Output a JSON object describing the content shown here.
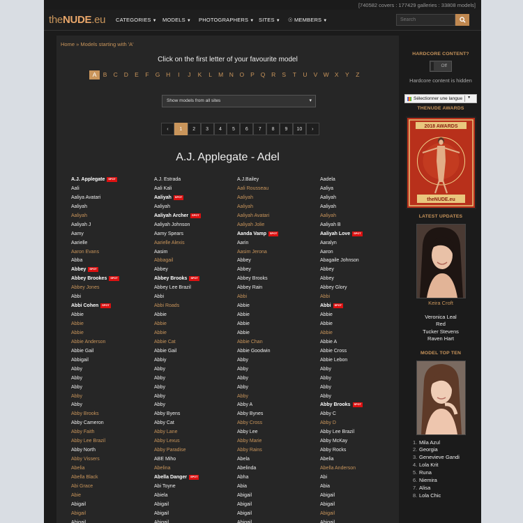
{
  "stats": "[740582 covers : 177429 galleries : 33808 models]",
  "logo": {
    "prefix": "the",
    "main": "NUDE",
    "suffix": ".eu"
  },
  "nav": [
    {
      "label": "CATEGORIES"
    },
    {
      "label": "MODELS"
    },
    {
      "label": "PHOTOGRAPHERS"
    },
    {
      "label": "SITES"
    },
    {
      "label": "MEMBERS"
    }
  ],
  "search": {
    "placeholder": "Search"
  },
  "breadcrumb": {
    "home": "Home",
    "sep": " » ",
    "current": "Models starting with 'A'"
  },
  "instruction": "Click on the first letter of your favourite model",
  "letters": [
    "A",
    "B",
    "C",
    "D",
    "E",
    "F",
    "G",
    "H",
    "I",
    "J",
    "K",
    "L",
    "M",
    "N",
    "O",
    "P",
    "Q",
    "R",
    "S",
    "T",
    "U",
    "V",
    "W",
    "X",
    "Y",
    "Z"
  ],
  "active_letter": "A",
  "site_filter": {
    "selected": "Show models from all sites"
  },
  "pagination": {
    "prev": "‹",
    "pages": [
      "1",
      "2",
      "3",
      "4",
      "5",
      "6",
      "7",
      "8",
      "9",
      "10"
    ],
    "active": "1",
    "next": "›"
  },
  "range_title": "A.J. Applegate - Adel",
  "spot_label": "SPOT",
  "columns": [
    [
      {
        "name": "A.J. Applegate",
        "style": "b",
        "spot": true
      },
      {
        "name": "Aali",
        "style": "w"
      },
      {
        "name": "Aaliya Avatari",
        "style": "w"
      },
      {
        "name": "Aaliyah",
        "style": "w"
      },
      {
        "name": "Aaliyah",
        "style": "o"
      },
      {
        "name": "Aaliyah J",
        "style": "w"
      },
      {
        "name": "Aamy",
        "style": "w"
      },
      {
        "name": "Aarielle",
        "style": "w"
      },
      {
        "name": "Aaron Evans",
        "style": "o"
      },
      {
        "name": "Abba",
        "style": "w"
      },
      {
        "name": "Abbey",
        "style": "b",
        "spot": true
      },
      {
        "name": "Abbey Brookes",
        "style": "b",
        "spot": true
      },
      {
        "name": "Abbey Jones",
        "style": "o"
      },
      {
        "name": "Abbi",
        "style": "w"
      },
      {
        "name": "Abbi Cohen",
        "style": "b",
        "spot": true
      },
      {
        "name": "Abbie",
        "style": "w"
      },
      {
        "name": "Abbie",
        "style": "o"
      },
      {
        "name": "Abbie",
        "style": "o"
      },
      {
        "name": "Abbie Anderson",
        "style": "o"
      },
      {
        "name": "Abbie Gail",
        "style": "w"
      },
      {
        "name": "Abbigail",
        "style": "w"
      },
      {
        "name": "Abby",
        "style": "w"
      },
      {
        "name": "Abby",
        "style": "w"
      },
      {
        "name": "Abby",
        "style": "w"
      },
      {
        "name": "Abby",
        "style": "o"
      },
      {
        "name": "Abby",
        "style": "w"
      },
      {
        "name": "Abby Brooks",
        "style": "o"
      },
      {
        "name": "Abby Cameron",
        "style": "w"
      },
      {
        "name": "Abby Faith",
        "style": "o"
      },
      {
        "name": "Abby Lee Brazil",
        "style": "o"
      },
      {
        "name": "Abby North",
        "style": "w"
      },
      {
        "name": "Abby Vissers",
        "style": "o"
      },
      {
        "name": "Abelia",
        "style": "o"
      },
      {
        "name": "Abella Black",
        "style": "o"
      },
      {
        "name": "Abi Grace",
        "style": "o"
      },
      {
        "name": "Abie",
        "style": "o"
      },
      {
        "name": "Abigail",
        "style": "w"
      },
      {
        "name": "Abigail",
        "style": "o"
      },
      {
        "name": "Abigail",
        "style": "w"
      }
    ],
    [
      {
        "name": "A.J. Estrada",
        "style": "w"
      },
      {
        "name": "Aali Kali",
        "style": "w"
      },
      {
        "name": "Aaliyah",
        "style": "b",
        "spot": true
      },
      {
        "name": "Aaliyah",
        "style": "w"
      },
      {
        "name": "Aaliyah Archer",
        "style": "b",
        "spot": true
      },
      {
        "name": "Aaliyah Johnson",
        "style": "w"
      },
      {
        "name": "Aamy Spears",
        "style": "w"
      },
      {
        "name": "Aarielle Alexis",
        "style": "o"
      },
      {
        "name": "Aasim",
        "style": "w"
      },
      {
        "name": "Abbagail",
        "style": "o"
      },
      {
        "name": "Abbey",
        "style": "w"
      },
      {
        "name": "Abbey Brooks",
        "style": "b",
        "spot": true
      },
      {
        "name": "Abbey Lee Brazil",
        "style": "w"
      },
      {
        "name": "Abbi",
        "style": "w"
      },
      {
        "name": "Abbi Roads",
        "style": "o"
      },
      {
        "name": "Abbie",
        "style": "w"
      },
      {
        "name": "Abbie",
        "style": "o"
      },
      {
        "name": "Abbie",
        "style": "o"
      },
      {
        "name": "Abbie Cat",
        "style": "o"
      },
      {
        "name": "Abbie Gail",
        "style": "w"
      },
      {
        "name": "Abbiy",
        "style": "w"
      },
      {
        "name": "Abby",
        "style": "w"
      },
      {
        "name": "Abby",
        "style": "w"
      },
      {
        "name": "Abby",
        "style": "w"
      },
      {
        "name": "Abby",
        "style": "w"
      },
      {
        "name": "Abby",
        "style": "w"
      },
      {
        "name": "Abby Byens",
        "style": "w"
      },
      {
        "name": "Abby Cat",
        "style": "w"
      },
      {
        "name": "Abby Lane",
        "style": "o"
      },
      {
        "name": "Abby Lexus",
        "style": "o"
      },
      {
        "name": "Abby Paradise",
        "style": "o"
      },
      {
        "name": "ABE Miho",
        "style": "w"
      },
      {
        "name": "Abelina",
        "style": "o"
      },
      {
        "name": "Abella Danger",
        "style": "b",
        "spot": true
      },
      {
        "name": "Abi Toyne",
        "style": "w"
      },
      {
        "name": "Abiela",
        "style": "w"
      },
      {
        "name": "Abigail",
        "style": "w"
      },
      {
        "name": "Abigail",
        "style": "w"
      },
      {
        "name": "Abigail",
        "style": "w"
      }
    ],
    [
      {
        "name": "A.J.Bailey",
        "style": "w"
      },
      {
        "name": "Aali Rousseau",
        "style": "o"
      },
      {
        "name": "Aaliyah",
        "style": "o"
      },
      {
        "name": "Aaliyah",
        "style": "o"
      },
      {
        "name": "Aaliyah Avatari",
        "style": "o"
      },
      {
        "name": "Aaliyah Jolie",
        "style": "o"
      },
      {
        "name": "Aanda Vamp",
        "style": "b",
        "spot": true
      },
      {
        "name": "Aarin",
        "style": "w"
      },
      {
        "name": "Aasim Jerona",
        "style": "o"
      },
      {
        "name": "Abbey",
        "style": "w"
      },
      {
        "name": "Abbey",
        "style": "w"
      },
      {
        "name": "Abbey Brooks",
        "style": "w"
      },
      {
        "name": "Abbey Rain",
        "style": "w"
      },
      {
        "name": "Abbi",
        "style": "o"
      },
      {
        "name": "Abbie",
        "style": "w"
      },
      {
        "name": "Abbie",
        "style": "w"
      },
      {
        "name": "Abbie",
        "style": "w"
      },
      {
        "name": "Abbie",
        "style": "w"
      },
      {
        "name": "Abbie Chan",
        "style": "o"
      },
      {
        "name": "Abbie Goodwin",
        "style": "w"
      },
      {
        "name": "Abby",
        "style": "w"
      },
      {
        "name": "Abby",
        "style": "w"
      },
      {
        "name": "Abby",
        "style": "w"
      },
      {
        "name": "Abby",
        "style": "w"
      },
      {
        "name": "Abby",
        "style": "o"
      },
      {
        "name": "Abby A",
        "style": "w"
      },
      {
        "name": "Abby Bynes",
        "style": "w"
      },
      {
        "name": "Abby Cross",
        "style": "o"
      },
      {
        "name": "Abby Lee",
        "style": "w"
      },
      {
        "name": "Abby Marie",
        "style": "o"
      },
      {
        "name": "Abby Rains",
        "style": "o"
      },
      {
        "name": "Abela",
        "style": "w"
      },
      {
        "name": "Abelinda",
        "style": "w"
      },
      {
        "name": "Abha",
        "style": "w"
      },
      {
        "name": "Abia",
        "style": "w"
      },
      {
        "name": "Abigail",
        "style": "w"
      },
      {
        "name": "Abigail",
        "style": "w"
      },
      {
        "name": "Abigail",
        "style": "w"
      },
      {
        "name": "Abigail",
        "style": "w"
      }
    ],
    [
      {
        "name": "Aadela",
        "style": "w"
      },
      {
        "name": "Aaliya",
        "style": "w"
      },
      {
        "name": "Aaliyah",
        "style": "w"
      },
      {
        "name": "Aaliyah",
        "style": "w"
      },
      {
        "name": "Aaliyah",
        "style": "o"
      },
      {
        "name": "Aaliyah B",
        "style": "w"
      },
      {
        "name": "Aaliyah Love",
        "style": "b",
        "spot": true
      },
      {
        "name": "Aaralyn",
        "style": "w"
      },
      {
        "name": "Aaron",
        "style": "w"
      },
      {
        "name": "Abagaile Johnson",
        "style": "w"
      },
      {
        "name": "Abbey",
        "style": "w"
      },
      {
        "name": "Abbey",
        "style": "w"
      },
      {
        "name": "Abbey Glory",
        "style": "w"
      },
      {
        "name": "Abbi",
        "style": "o"
      },
      {
        "name": "Abbi",
        "style": "b",
        "spot": true
      },
      {
        "name": "Abbie",
        "style": "w"
      },
      {
        "name": "Abbie",
        "style": "w"
      },
      {
        "name": "Abbie",
        "style": "o"
      },
      {
        "name": "Abbie A",
        "style": "w"
      },
      {
        "name": "Abbie Cross",
        "style": "w"
      },
      {
        "name": "Abbie Lebon",
        "style": "w"
      },
      {
        "name": "Abby",
        "style": "w"
      },
      {
        "name": "Abby",
        "style": "w"
      },
      {
        "name": "Abby",
        "style": "w"
      },
      {
        "name": "Abby",
        "style": "w"
      },
      {
        "name": "Abby Brooks",
        "style": "b",
        "spot": true
      },
      {
        "name": "Abby C",
        "style": "w"
      },
      {
        "name": "Abby D",
        "style": "o"
      },
      {
        "name": "Abby Lee Brazil",
        "style": "w"
      },
      {
        "name": "Abby McKay",
        "style": "w"
      },
      {
        "name": "Abby Rocks",
        "style": "w"
      },
      {
        "name": "Abelia",
        "style": "w"
      },
      {
        "name": "Abella Anderson",
        "style": "o"
      },
      {
        "name": "Abi",
        "style": "w"
      },
      {
        "name": "Abia",
        "style": "w"
      },
      {
        "name": "Abigail",
        "style": "w"
      },
      {
        "name": "Abigail",
        "style": "w"
      },
      {
        "name": "Abigail",
        "style": "o"
      },
      {
        "name": "Abigail",
        "style": "w"
      }
    ]
  ],
  "sidebar": {
    "hardcore_title": "HARDCORE CONTENT?",
    "toggle_label": "Off",
    "hardcore_note": "Hardcore content is hidden",
    "language_select": "Sélectionner une langue",
    "language_arrow": "▼",
    "awards_title": "THENUDE AWARDS",
    "awards_poster": {
      "top_text": "2018 AWARDS",
      "bottom_text": "theNUDE.eu"
    },
    "latest_title": "LATEST UPDATES",
    "latest_featured": "Keira Croft",
    "latest_list": [
      "Veronica Leal",
      "Red",
      "Tucker Stevens",
      "Raven Hart"
    ],
    "topten_title": "MODEL TOP TEN",
    "topten": [
      "Mila Azul",
      "Georgia",
      "Genevieve Gandi",
      "Lola Krit",
      "Runa",
      "Niemira",
      "Alisa",
      "Lola Chic"
    ]
  },
  "colors": {
    "accent": "#c9955b",
    "background": "#1b1b1b",
    "panel": "#262626",
    "spot": "#dd1111"
  }
}
